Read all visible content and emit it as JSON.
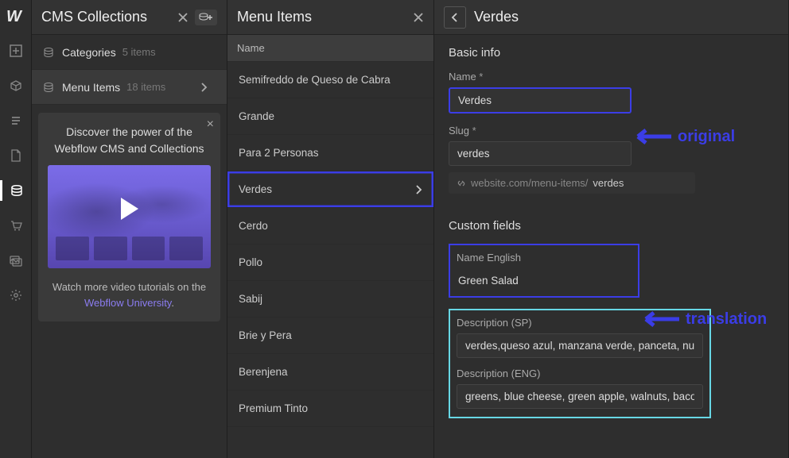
{
  "panels": {
    "collections": {
      "title": "CMS Collections"
    },
    "items": {
      "title": "Menu Items",
      "column_header": "Name"
    },
    "detail": {
      "title": "Verdes"
    }
  },
  "collections": [
    {
      "name": "Categories",
      "count": "5 items",
      "active": false
    },
    {
      "name": "Menu Items",
      "count": "18 items",
      "active": true
    }
  ],
  "items": [
    {
      "name": "Semifreddo de Queso de Cabra"
    },
    {
      "name": "Grande"
    },
    {
      "name": "Para 2 Personas"
    },
    {
      "name": "Verdes",
      "selected": true
    },
    {
      "name": "Cerdo"
    },
    {
      "name": "Pollo"
    },
    {
      "name": "Sabij"
    },
    {
      "name": "Brie y Pera"
    },
    {
      "name": "Berenjena"
    },
    {
      "name": "Premium Tinto"
    }
  ],
  "detail": {
    "basic_info_title": "Basic info",
    "name_label": "Name",
    "name_value": "Verdes",
    "slug_label": "Slug",
    "slug_value": "verdes",
    "slug_prefix": "website.com/menu-items/",
    "custom_fields_title": "Custom fields",
    "name_en_label": "Name English",
    "name_en_value": "Green Salad",
    "desc_sp_label": "Description (SP)",
    "desc_sp_value": "verdes,queso azul, manzana verde, panceta, nueces",
    "desc_eng_label": "Description (ENG)",
    "desc_eng_value": "greens, blue cheese, green apple, walnuts, bacon"
  },
  "promo": {
    "heading": "Discover the power of the Webflow CMS and Collections",
    "footer_pre": "Watch more video tutorials on the ",
    "footer_link": "Webflow University",
    "footer_post": "."
  },
  "annotations": {
    "original": "original",
    "translation": "translation"
  }
}
